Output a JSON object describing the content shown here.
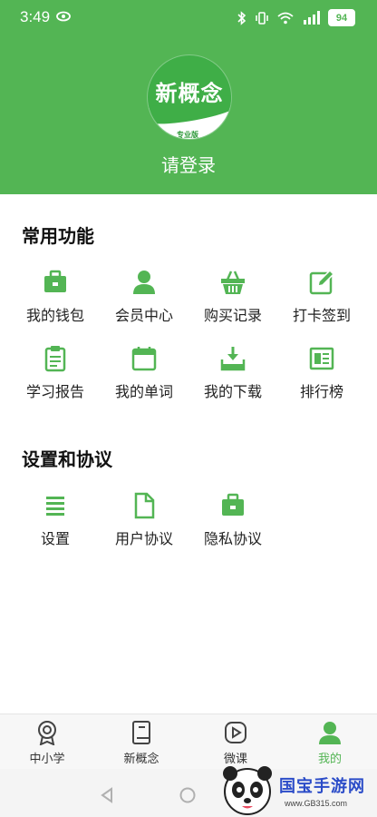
{
  "status_bar": {
    "time": "3:49",
    "battery": "94",
    "icons": [
      "eye-icon",
      "bluetooth-icon",
      "vibrate-icon",
      "wifi-icon",
      "signal-icon",
      "battery-icon"
    ]
  },
  "profile": {
    "avatar_text": "新概念",
    "avatar_badge": "专业版",
    "login_label": "请登录"
  },
  "common_functions": {
    "title": "常用功能",
    "items": [
      {
        "label": "我的钱包",
        "icon": "wallet-icon"
      },
      {
        "label": "会员中心",
        "icon": "user-icon"
      },
      {
        "label": "购买记录",
        "icon": "basket-icon"
      },
      {
        "label": "打卡签到",
        "icon": "edit-icon"
      },
      {
        "label": "学习报告",
        "icon": "clipboard-icon"
      },
      {
        "label": "我的单词",
        "icon": "calendar-icon"
      },
      {
        "label": "我的下载",
        "icon": "download-icon"
      },
      {
        "label": "排行榜",
        "icon": "ranking-icon"
      }
    ]
  },
  "settings_section": {
    "title": "设置和协议",
    "items": [
      {
        "label": "设置",
        "icon": "menu-icon"
      },
      {
        "label": "用户协议",
        "icon": "document-icon"
      },
      {
        "label": "隐私协议",
        "icon": "briefcase-icon"
      }
    ]
  },
  "tab_bar": {
    "tabs": [
      {
        "label": "中小学",
        "icon": "medal-icon"
      },
      {
        "label": "新概念",
        "icon": "book-icon"
      },
      {
        "label": "微课",
        "icon": "video-icon"
      },
      {
        "label": "我的",
        "icon": "user-icon",
        "active": true
      }
    ]
  },
  "watermark": {
    "brand": "国宝手游网",
    "url": "www.GB315.com"
  },
  "colors": {
    "accent": "#53b554",
    "background": "#f6f5fb"
  }
}
